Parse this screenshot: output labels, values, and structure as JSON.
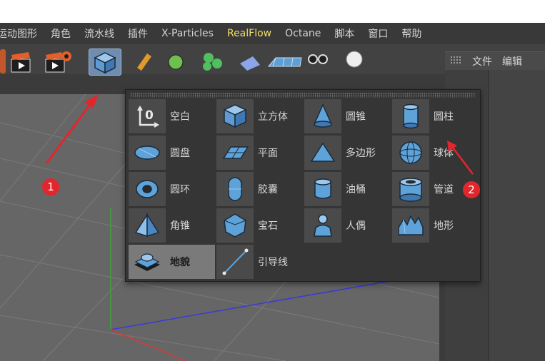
{
  "menubar": {
    "items": [
      "运动图形",
      "角色",
      "流水线",
      "插件",
      "X-Particles",
      "RealFlow",
      "Octane",
      "脚本",
      "窗口",
      "帮助"
    ],
    "highlight_index": 5
  },
  "panel_tabs": [
    "文件",
    "编辑"
  ],
  "popup": {
    "columns": [
      [
        {
          "label": "空白",
          "icon": "null-object-icon"
        },
        {
          "label": "圆盘",
          "icon": "disc-icon"
        },
        {
          "label": "圆环",
          "icon": "torus-icon"
        },
        {
          "label": "角锥",
          "icon": "pyramid-icon"
        },
        {
          "label": "地貌",
          "icon": "landscape-icon",
          "selected": true
        }
      ],
      [
        {
          "label": "立方体",
          "icon": "cube-icon"
        },
        {
          "label": "平面",
          "icon": "plane-icon"
        },
        {
          "label": "胶囊",
          "icon": "capsule-icon"
        },
        {
          "label": "宝石",
          "icon": "gem-icon"
        },
        {
          "label": "引导线",
          "icon": "guide-line-icon"
        }
      ],
      [
        {
          "label": "圆锥",
          "icon": "cone-icon"
        },
        {
          "label": "多边形",
          "icon": "polygon-icon"
        },
        {
          "label": "油桶",
          "icon": "oil-tank-icon"
        },
        {
          "label": "人偶",
          "icon": "figure-icon"
        }
      ],
      [
        {
          "label": "圆柱",
          "icon": "cylinder-icon"
        },
        {
          "label": "球体",
          "icon": "sphere-icon"
        },
        {
          "label": "管道",
          "icon": "tube-icon"
        },
        {
          "label": "地形",
          "icon": "terrain-icon"
        }
      ]
    ]
  },
  "annotations": {
    "badge_1": "1",
    "badge_2": "2"
  },
  "colors": {
    "accent_blue": "#5da3d9",
    "highlight_menu": "#f2de6a",
    "annotation_red": "#e3262c"
  }
}
